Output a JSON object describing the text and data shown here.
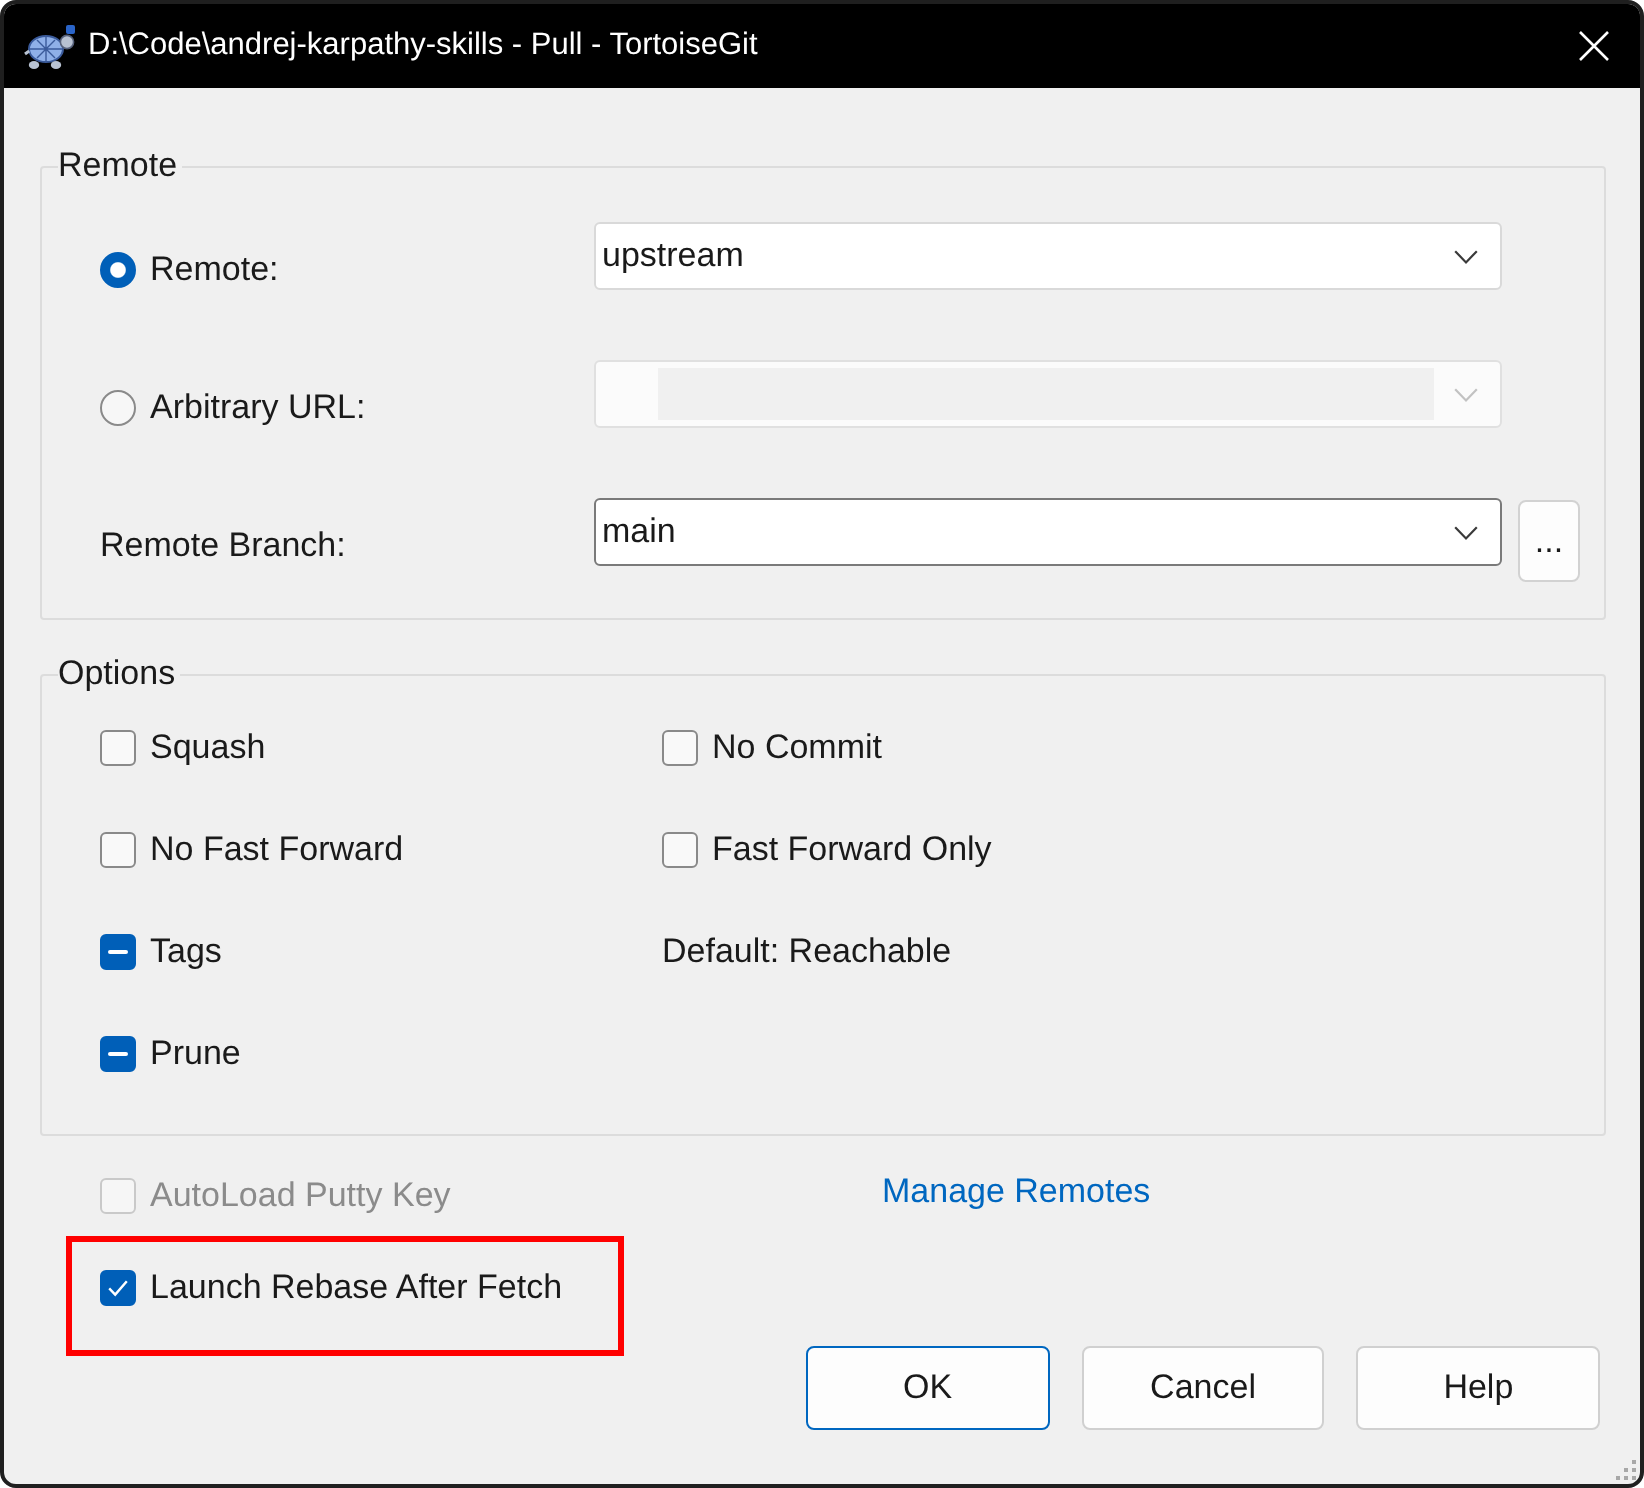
{
  "window": {
    "title": "D:\\Code\\andrej-karpathy-skills - Pull - TortoiseGit"
  },
  "remote_group": {
    "title": "Remote",
    "sources": [
      {
        "label": "Remote:",
        "selected": true,
        "combo": {
          "value": "upstream",
          "disabled": false
        }
      },
      {
        "label": "Arbitrary URL:",
        "selected": false,
        "combo": {
          "disabled": true
        }
      }
    ],
    "branch": {
      "label": "Remote Branch:",
      "value": "main",
      "focused": true,
      "browse_button": "..."
    }
  },
  "options_group": {
    "title": "Options",
    "left": [
      {
        "label": "Squash",
        "checked": false,
        "indeterminate": false
      },
      {
        "label": "No Fast Forward",
        "checked": false,
        "indeterminate": false
      },
      {
        "label": "Tags",
        "indeterminate": true
      },
      {
        "label": "Prune",
        "indeterminate": true
      }
    ],
    "right": [
      {
        "kind": "checkbox",
        "label": "No Commit",
        "checked": false,
        "indeterminate": false
      },
      {
        "kind": "checkbox",
        "label": "Fast Forward Only",
        "checked": false,
        "indeterminate": false
      },
      {
        "kind": "text",
        "label": "Default: Reachable"
      }
    ]
  },
  "bottom": {
    "checkboxes": [
      {
        "label": "AutoLoad Putty Key",
        "checked": false,
        "disabled": true,
        "highlighted": false
      },
      {
        "label": "Launch Rebase After Fetch",
        "checked": true,
        "disabled": false,
        "highlighted": true
      }
    ],
    "link": "Manage Remotes",
    "buttons": [
      {
        "label": "OK",
        "default": true
      },
      {
        "label": "Cancel",
        "default": false
      },
      {
        "label": "Help",
        "default": false
      }
    ]
  }
}
